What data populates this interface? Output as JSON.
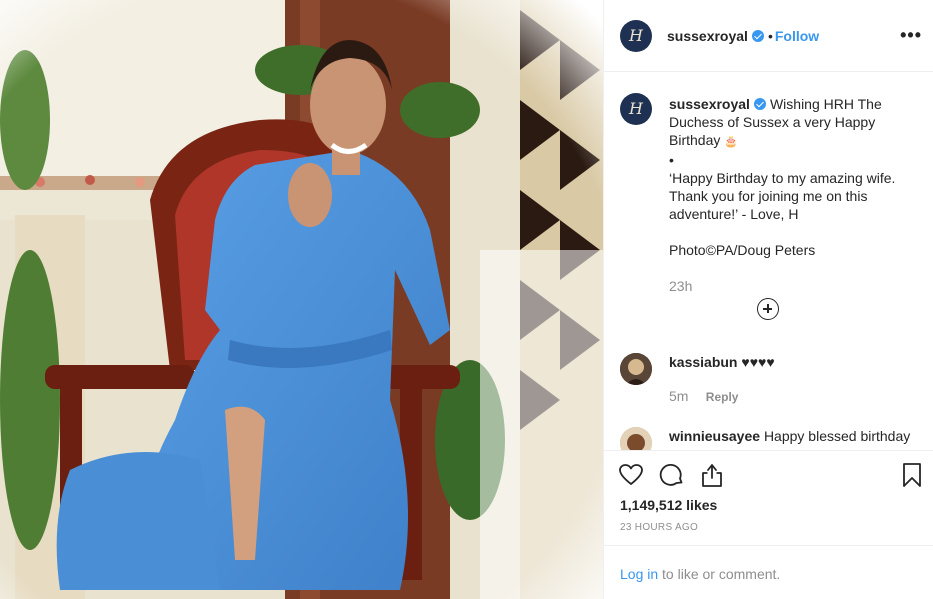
{
  "post": {
    "username": "sussexroyal",
    "follow_label": "Follow",
    "more_label": "•••",
    "separator": "•",
    "avatar_monogram": "H"
  },
  "caption": {
    "username": "sussexroyal",
    "text": "Wishing HRH The Duchess of Sussex a very Happy Birthday",
    "bullet": "•",
    "quote": "‘Happy Birthday to my amazing wife. Thank you for joining me on this adventure!’ - Love, H",
    "credit": "Photo©PA/Doug Peters",
    "time": "23h"
  },
  "comments": [
    {
      "username": "kassiabun",
      "text": "♥♥♥♥",
      "time": "5m",
      "reply_label": "Reply"
    },
    {
      "username": "winnieusayee",
      "text": "Happy blessed birthday"
    }
  ],
  "icons": {
    "like": "heart-icon",
    "comment": "comment-icon",
    "share": "share-icon",
    "save": "bookmark-icon",
    "load_more": "plus-circle-icon",
    "more_options": "more-options-icon"
  },
  "likes": "1,149,512 likes",
  "timestamp": "23 HOURS AGO",
  "login": {
    "link_label": "Log in",
    "rest_label": "to like or comment."
  },
  "colors": {
    "accent": "#3897f0",
    "text": "#262626",
    "muted": "#8e8e8e",
    "border": "#efefef",
    "dress": "#4a8fd6"
  }
}
